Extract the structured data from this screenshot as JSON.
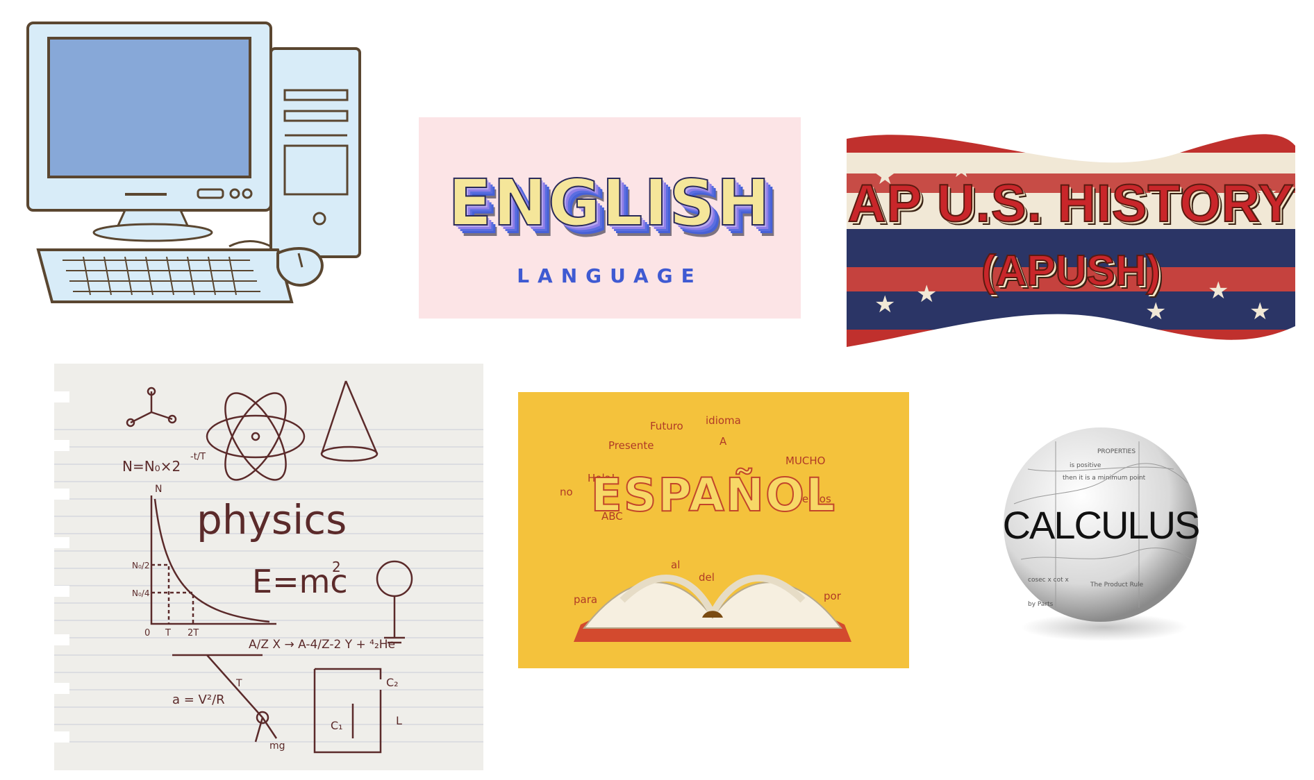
{
  "english": {
    "title": "ENGLISH",
    "subtitle": "LANGUAGE"
  },
  "apush": {
    "line1": "AP U.S. HISTORY",
    "line2": "(APUSH)"
  },
  "physics": {
    "title": "physics",
    "formula_energy": "E=mc",
    "formula_energy_exp": "2",
    "formula_decay": "N=N₀×2",
    "formula_decay_exp": "-t/T",
    "formula_nuclear": "A/Z X → A-4/Z-2 Y + ⁴₂He",
    "formula_accel": "a = V²/R",
    "label_n": "N",
    "label_n2": "N₀/2",
    "label_n4": "N₀/4",
    "label_t": "T",
    "label_2t": "2T",
    "label_zero": "0",
    "label_c1": "C₁",
    "label_c2": "C₂",
    "label_l": "L",
    "label_mg": "mg",
    "label_tv": "T"
  },
  "espanol": {
    "title": "ESPAÑOL",
    "doodles": [
      "Futuro",
      "idioma",
      "Presente",
      "MUCHO",
      "Hola!",
      "ABC",
      "verbos",
      "no",
      "al",
      "del",
      "para",
      "A",
      "por"
    ]
  },
  "calculus": {
    "title": "CALCULUS",
    "notes": [
      "is positive",
      "then it is a minimum point",
      "The Product Rule",
      "cosec x cot x",
      "PROPERTIES",
      "by Parts"
    ]
  },
  "colors": {
    "computer_screen": "#87a8d8",
    "computer_body": "#d8ecf8",
    "english_bg": "#fce4e6",
    "english_accent": "#3f5ad2",
    "apush_red": "#c9262a",
    "apush_navy": "#2b3566",
    "espanol_bg": "#f4c23c",
    "physics_ink": "#5b2a2a"
  },
  "icons": [
    "computer-icon",
    "keyboard-icon",
    "mouse-icon",
    "atom-icon",
    "cone-icon",
    "book-icon",
    "sphere-icon",
    "flag-banner"
  ]
}
